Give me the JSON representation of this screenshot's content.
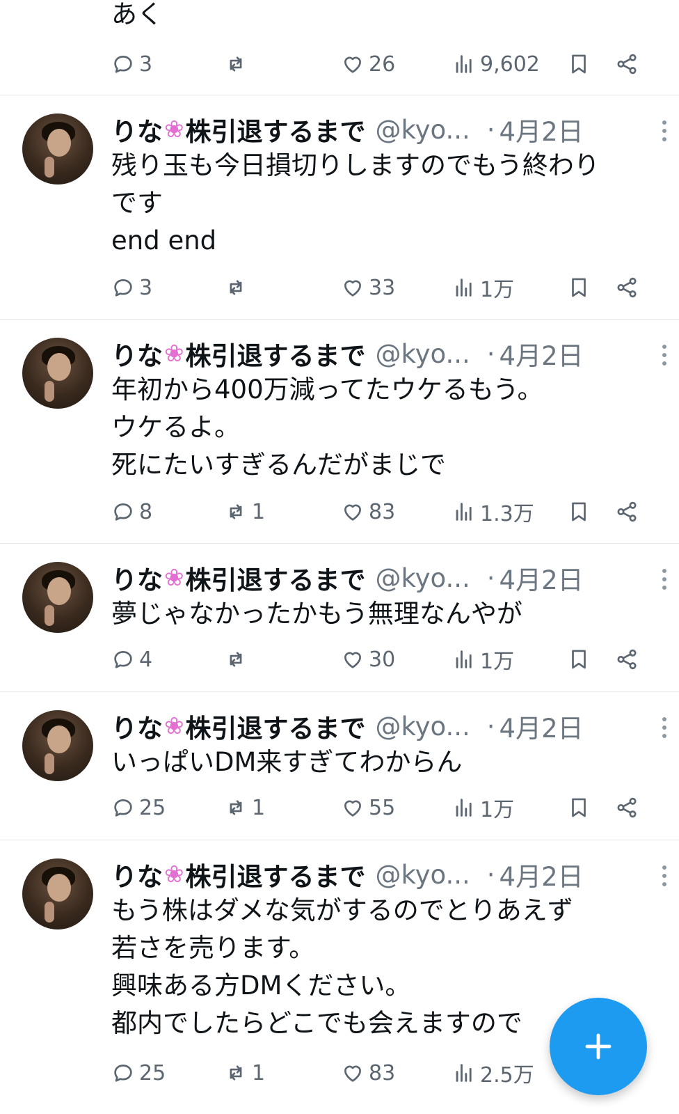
{
  "partial_tweet": {
    "text": "あく",
    "stats": {
      "replies": "3",
      "reposts": "",
      "likes": "26",
      "views": "9,602"
    }
  },
  "tweets": [
    {
      "name": "りな",
      "name_icon": "flower-emoji",
      "name_suffix": "株引退するまで",
      "handle": "@kyo...",
      "separator": "·",
      "date": "4月2日",
      "lines": [
        "残り玉も今日損切りしますのでもう終わり",
        "です",
        "end end"
      ],
      "stats": {
        "replies": "3",
        "reposts": "",
        "likes": "33",
        "views": "1万"
      }
    },
    {
      "name": "りな",
      "name_icon": "flower-emoji",
      "name_suffix": "株引退するまで",
      "handle": "@kyo...",
      "separator": "·",
      "date": "4月2日",
      "lines": [
        "年初から400万減ってたウケるもう。",
        "ウケるよ。",
        "死にたいすぎるんだがまじで"
      ],
      "stats": {
        "replies": "8",
        "reposts": "1",
        "likes": "83",
        "views": "1.3万"
      }
    },
    {
      "name": "りな",
      "name_icon": "flower-emoji",
      "name_suffix": "株引退するまで",
      "handle": "@kyo...",
      "separator": "·",
      "date": "4月2日",
      "lines": [
        "夢じゃなかったかもう無理なんやが"
      ],
      "stats": {
        "replies": "4",
        "reposts": "",
        "likes": "30",
        "views": "1万"
      }
    },
    {
      "name": "りな",
      "name_icon": "flower-emoji",
      "name_suffix": "株引退するまで",
      "handle": "@kyo...",
      "separator": "·",
      "date": "4月2日",
      "lines": [
        "いっぱいDM来すぎてわからん"
      ],
      "stats": {
        "replies": "25",
        "reposts": "1",
        "likes": "55",
        "views": "1万"
      }
    },
    {
      "name": "りな",
      "name_icon": "flower-emoji",
      "name_suffix": "株引退するまで",
      "handle": "@kyo...",
      "separator": "·",
      "date": "4月2日",
      "lines": [
        "もう株はダメな気がするのでとりあえず",
        "若さを売ります。",
        "興味ある方DMください。",
        "都内でしたらどこでも会えますので"
      ],
      "stats": {
        "replies": "25",
        "reposts": "1",
        "likes": "83",
        "views": "2.5万"
      }
    }
  ],
  "fab": {
    "icon": "plus-icon",
    "color": "#1d9bf0"
  },
  "colors": {
    "text": "#0f1419",
    "muted": "#6b7680",
    "divider": "#e6e9ec",
    "accent": "#1d9bf0",
    "flower": "#e36fd3"
  }
}
